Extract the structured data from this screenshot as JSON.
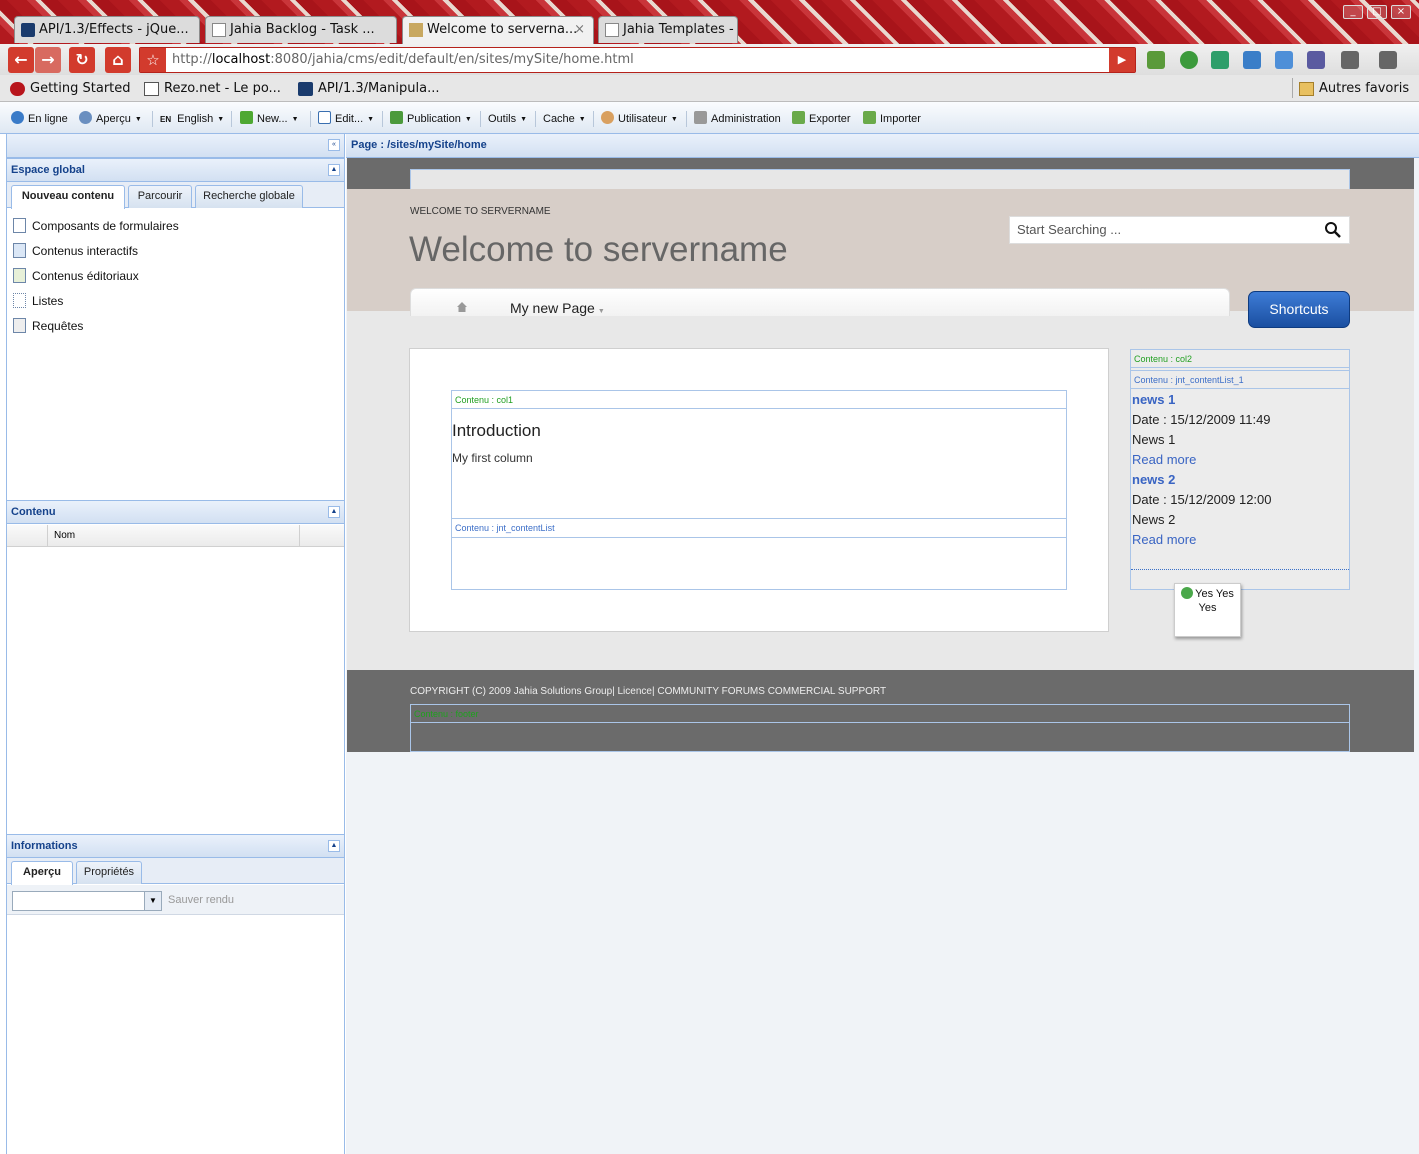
{
  "browser": {
    "tabs": [
      {
        "label": "API/1.3/Effects - jQue..."
      },
      {
        "label": "Jahia Backlog - Task ..."
      },
      {
        "label": "Welcome to serverna..."
      },
      {
        "label": "Jahia Templates -"
      }
    ],
    "url_prefix": "http://",
    "url_host": "localhost",
    "url_rest": ":8080/jahia/cms/edit/default/en/sites/mySite/home.html",
    "bookmarks": [
      {
        "label": "Getting Started"
      },
      {
        "label": "Rezo.net - Le po..."
      },
      {
        "label": "API/1.3/Manipula..."
      }
    ],
    "other_bookmarks": "Autres favoris"
  },
  "jahia_toolbar": {
    "online": "En ligne",
    "preview": "Aperçu",
    "lang_badge": "EN",
    "language": "English",
    "new": "New...",
    "edit": "Edit...",
    "publication": "Publication",
    "tools": "Outils",
    "cache": "Cache",
    "user": "Utilisateur",
    "admin": "Administration",
    "export": "Exporter",
    "import": "Importer"
  },
  "left_panel": {
    "global_title": "Espace global",
    "tabs": [
      "Nouveau contenu",
      "Parcourir",
      "Recherche globale"
    ],
    "items": [
      {
        "label": "Composants de formulaires"
      },
      {
        "label": "Contenus interactifs"
      },
      {
        "label": "Contenus éditoriaux"
      },
      {
        "label": "Listes"
      },
      {
        "label": "Requêtes"
      }
    ],
    "content_title": "Contenu",
    "content_column": "Nom",
    "info_title": "Informations",
    "info_tabs": [
      "Aperçu",
      "Propriétés"
    ],
    "save_render": "Sauver rendu"
  },
  "page": {
    "path_label": "Page : /sites/mySite/home",
    "welcome_small": "WELCOME TO SERVERNAME",
    "welcome_big": "Welcome to servername",
    "search_placeholder": "Start Searching ...",
    "menu_item": "My new Page",
    "shortcuts": "Shortcuts",
    "col1_label": "Contenu : col1",
    "intro_title": "Introduction",
    "intro_text": "My first column",
    "list_label": "Contenu : jnt_contentList",
    "col2_label": "Contenu : col2",
    "list1_label": "Contenu : jnt_contentList_1",
    "news": [
      {
        "title": "news 1",
        "date": "Date : 15/12/2009  11:49",
        "body": "News 1",
        "more": "Read more"
      },
      {
        "title": "news 2",
        "date": "Date : 15/12/2009  12:00",
        "body": "News 2",
        "more": "Read more"
      }
    ],
    "yes_tip": "Yes Yes Yes",
    "copyright": "COPYRIGHT (C) 2009 Jahia Solutions Group| Licence| COMMUNITY FORUMS COMMERCIAL SUPPORT",
    "footer_label": "Contenu : footer"
  }
}
